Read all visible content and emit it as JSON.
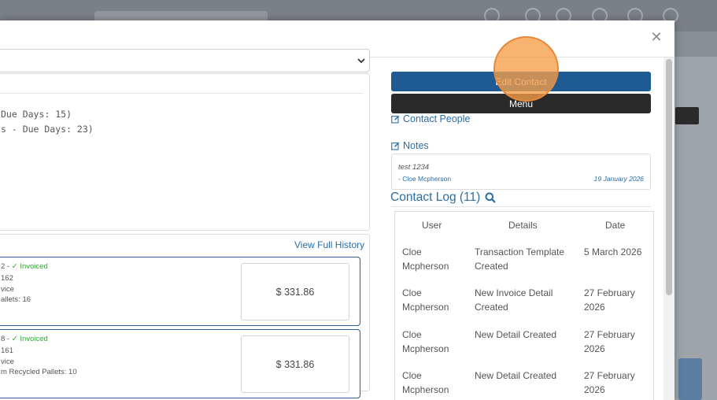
{
  "contact_panel": {
    "edit_contact_label": "Edit Contact",
    "menu_label": "Menu",
    "contact_people_label": "Contact People",
    "notes_label": "Notes",
    "note": {
      "text": "test 1234",
      "author": "- Cloe Mcpherson",
      "date": "19 January 2026"
    }
  },
  "terms": {
    "line1": "Due Days: 15)",
    "line2": "s - Due Days: 23)"
  },
  "history": {
    "view_full_history_label": "View Full History",
    "invoices": [
      {
        "status_prefix": "2 - ",
        "status": "Invoiced",
        "line1": "162",
        "line2": "vice",
        "line3": "allets: 16",
        "amount": "$ 331.86"
      },
      {
        "status_prefix": "8 - ",
        "status": "Invoiced",
        "line1": "161",
        "line2": "vice",
        "line3": "m Recycled Pallets: 10",
        "amount": "$ 331.86"
      }
    ]
  },
  "contact_log": {
    "title": "Contact Log (11)",
    "headers": {
      "user": "User",
      "details": "Details",
      "date": "Date"
    },
    "rows": [
      {
        "user": "Cloe Mcpherson",
        "details": "Transaction Template Created",
        "date": "5 March 2026"
      },
      {
        "user": "Cloe Mcpherson",
        "details": "New Invoice Detail Created",
        "date": "27 February 2026"
      },
      {
        "user": "Cloe Mcpherson",
        "details": "New Detail Created",
        "date": "27 February 2026"
      },
      {
        "user": "Cloe Mcpherson",
        "details": "New Detail Created",
        "date": "27 February 2026"
      }
    ]
  },
  "colors": {
    "accent": "#1e5a93",
    "link": "#2a6ea6",
    "invoiced": "#38a538",
    "dark_button": "#2a2a2a",
    "click_indicator": "#f59e46"
  },
  "icons": [
    "close-icon",
    "chevron-down-icon",
    "edit-icon",
    "search-icon",
    "check-icon"
  ]
}
